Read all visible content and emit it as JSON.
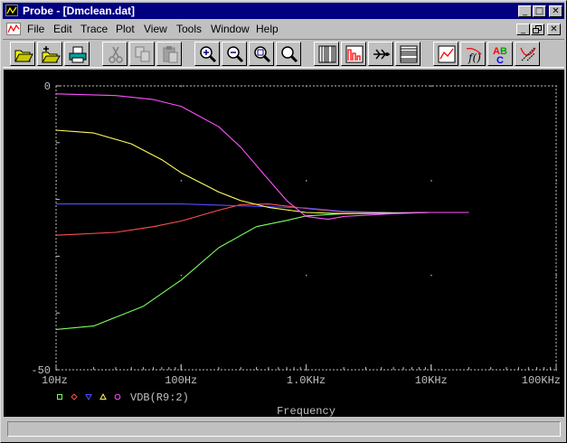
{
  "window": {
    "title": "Probe - [Dmclean.dat]"
  },
  "caption_buttons": {
    "minimize": "_",
    "maximize": "□",
    "close": "✕"
  },
  "menu": [
    "File",
    "Edit",
    "Trace",
    "Plot",
    "View",
    "Tools",
    "Window",
    "Help"
  ],
  "toolbar": [
    {
      "name": "open-file-icon"
    },
    {
      "name": "new-plot-icon"
    },
    {
      "name": "print-icon"
    },
    {
      "name": "cut-icon"
    },
    {
      "name": "copy-icon"
    },
    {
      "name": "paste-icon"
    },
    {
      "name": "zoom-in-icon"
    },
    {
      "name": "zoom-out-icon"
    },
    {
      "name": "zoom-area-icon"
    },
    {
      "name": "zoom-fit-icon"
    },
    {
      "name": "log-x-axis-icon"
    },
    {
      "name": "fourier-icon"
    },
    {
      "name": "performance-analysis-icon"
    },
    {
      "name": "log-y-axis-icon"
    },
    {
      "name": "add-trace-icon"
    },
    {
      "name": "eval-goal-function-icon"
    },
    {
      "name": "text-label-icon"
    },
    {
      "name": "mark-data-points-icon"
    }
  ],
  "chart_data": {
    "type": "line",
    "xlabel": "Frequency",
    "xscale": "log",
    "xlim": [
      10,
      100000
    ],
    "ylim": [
      -50,
      0
    ],
    "x_ticks": [
      "10Hz",
      "100Hz",
      "1.0KHz",
      "10KHz",
      "100KHz"
    ],
    "y_ticks": [
      "0",
      "-50"
    ],
    "legend_text": "VDB(R9:2)",
    "legend_position": "bottom-left",
    "grid": "dotted",
    "series": [
      {
        "marker": "square",
        "color": "#7cff5c",
        "x": [
          10,
          20,
          50,
          100,
          200,
          400,
          700,
          1000,
          2000,
          5000,
          10000,
          20000
        ],
        "y": [
          -42.9,
          -42.3,
          -38.8,
          -34.2,
          -28.5,
          -24.8,
          -23.7,
          -22.9,
          -22.5,
          -22.3,
          -22.3,
          -22.3
        ]
      },
      {
        "marker": "diamond",
        "color": "#ff5050",
        "x": [
          10,
          30,
          60,
          100,
          200,
          300,
          500,
          1000,
          2000,
          5000,
          10000,
          20000
        ],
        "y": [
          -26.3,
          -25.8,
          -24.8,
          -23.8,
          -21.9,
          -20.9,
          -20.8,
          -21.6,
          -22.2,
          -22.3,
          -22.3,
          -22.3
        ]
      },
      {
        "marker": "triangle-down",
        "color": "#5050ff",
        "x": [
          10,
          100,
          1000,
          2000,
          5000,
          10000,
          20000
        ],
        "y": [
          -20.8,
          -20.8,
          -21.5,
          -22.1,
          -22.3,
          -22.3,
          -22.3
        ]
      },
      {
        "marker": "triangle-up",
        "color": "#ffff60",
        "x": [
          10,
          20,
          40,
          70,
          100,
          200,
          300,
          500,
          1000,
          2000,
          5000,
          10000,
          20000
        ],
        "y": [
          -7.8,
          -8.3,
          -10.2,
          -13.0,
          -15.3,
          -18.7,
          -20.2,
          -21.4,
          -22.3,
          -22.5,
          -22.4,
          -22.3,
          -22.3
        ]
      },
      {
        "marker": "circle",
        "color": "#ff50ff",
        "x": [
          10,
          30,
          60,
          100,
          200,
          300,
          500,
          700,
          1000,
          1500,
          2000,
          5000,
          10000,
          20000
        ],
        "y": [
          -1.4,
          -1.7,
          -2.4,
          -3.6,
          -7.2,
          -10.8,
          -16.5,
          -20.2,
          -23.0,
          -23.5,
          -23.0,
          -22.5,
          -22.3,
          -22.3
        ]
      }
    ]
  }
}
